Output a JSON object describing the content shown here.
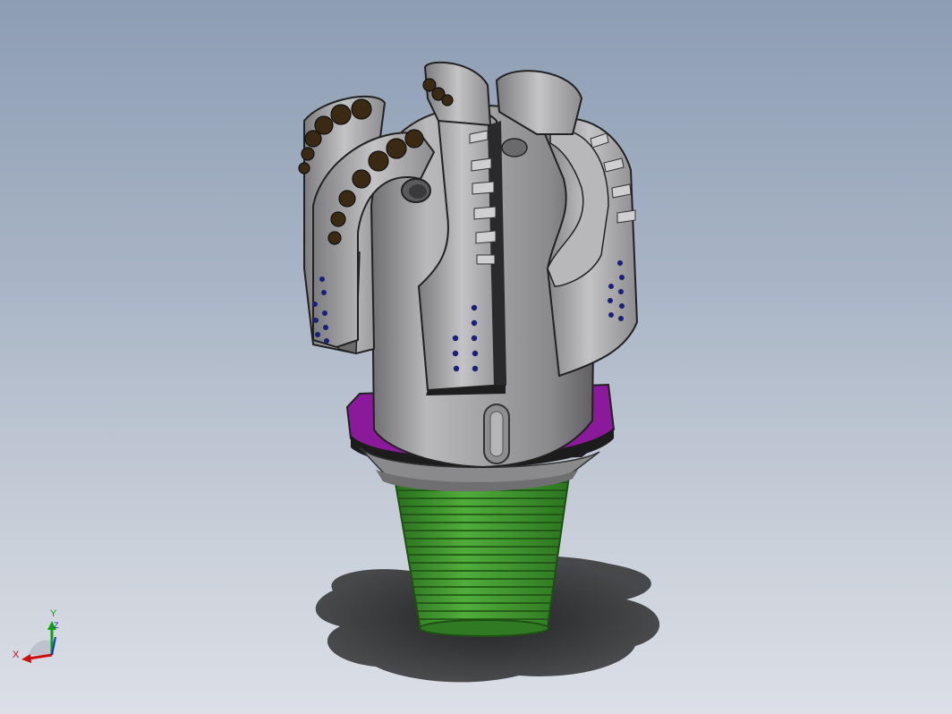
{
  "model": {
    "subject": "drill-bit-model"
  },
  "triad": {
    "x_label": "X",
    "y_label": "Y",
    "z_label": "Z"
  },
  "colors": {
    "background_top": "#8d9db3",
    "background_bottom": "#dcdfe6",
    "body": "#9a9a9c",
    "thread": "#3f9b2e",
    "ring": "#8a1a9a",
    "cutter": "#3a2a14",
    "nozzle_dot": "#1c1f7a",
    "axis_x": "#cc1010",
    "axis_y": "#10a010",
    "axis_z": "#1030cc"
  }
}
